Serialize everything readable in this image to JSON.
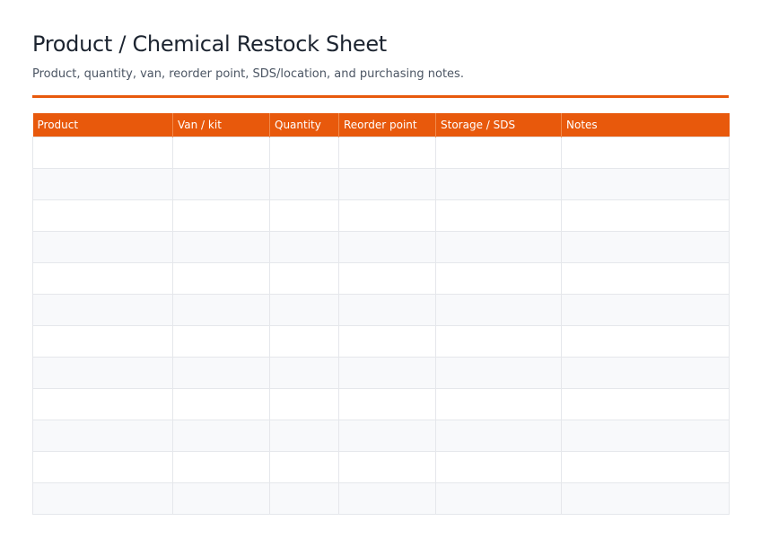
{
  "sheet": {
    "title": "Product / Chemical Restock Sheet",
    "subtitle": "Product, quantity, van, reorder point, SDS/location, and purchasing notes.",
    "accent_color": "#e8590c",
    "columns": [
      "Product",
      "Van / kit",
      "Quantity",
      "Reorder point",
      "Storage / SDS",
      "Notes"
    ],
    "rows": [
      [
        "",
        "",
        "",
        "",
        "",
        ""
      ],
      [
        "",
        "",
        "",
        "",
        "",
        ""
      ],
      [
        "",
        "",
        "",
        "",
        "",
        ""
      ],
      [
        "",
        "",
        "",
        "",
        "",
        ""
      ],
      [
        "",
        "",
        "",
        "",
        "",
        ""
      ],
      [
        "",
        "",
        "",
        "",
        "",
        ""
      ],
      [
        "",
        "",
        "",
        "",
        "",
        ""
      ],
      [
        "",
        "",
        "",
        "",
        "",
        ""
      ],
      [
        "",
        "",
        "",
        "",
        "",
        ""
      ],
      [
        "",
        "",
        "",
        "",
        "",
        ""
      ],
      [
        "",
        "",
        "",
        "",
        "",
        ""
      ],
      [
        "",
        "",
        "",
        "",
        "",
        ""
      ]
    ]
  }
}
